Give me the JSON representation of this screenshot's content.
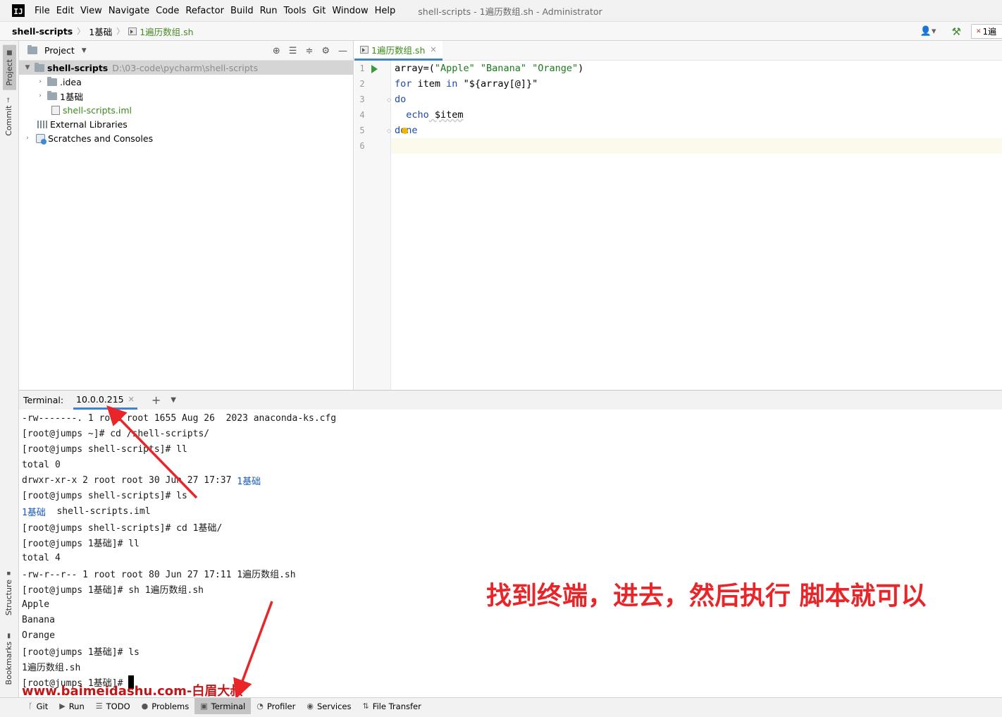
{
  "menubar": {
    "logo": "IJ",
    "items": [
      "File",
      "Edit",
      "View",
      "Navigate",
      "Code",
      "Refactor",
      "Build",
      "Run",
      "Tools",
      "Git",
      "Window",
      "Help"
    ],
    "window_title": "shell-scripts - 1遍历数组.sh - Administrator"
  },
  "navbar": {
    "project": "shell-scripts",
    "folder": "1基础",
    "file": "1遍历数组.sh",
    "run_config": "1遍"
  },
  "left_stripe": {
    "project": "Project",
    "commit": "Commit",
    "structure": "Structure",
    "bookmarks": "Bookmarks"
  },
  "project_pane": {
    "title": "Project",
    "tree": [
      {
        "name": "shell-scripts",
        "path": "D:\\03-code\\pycharm\\shell-scripts"
      },
      {
        "name": ".idea"
      },
      {
        "name": "1基础"
      },
      {
        "name": "shell-scripts.iml"
      },
      {
        "name": "External Libraries"
      },
      {
        "name": "Scratches and Consoles"
      }
    ]
  },
  "editor": {
    "tab": "1遍历数组.sh",
    "line_numbers": [
      "1",
      "2",
      "3",
      "4",
      "5",
      "6"
    ],
    "code": {
      "l1_a": "array=(",
      "l1_b": "\"Apple\" \"Banana\" \"Orange\"",
      "l1_c": ")",
      "l2_a": "for",
      "l2_b": " item ",
      "l2_c": "in",
      "l2_d": " \"${array[@]}\"",
      "l3": "do",
      "l4_a": "  echo",
      "l4_b": " $item",
      "l5": "done"
    }
  },
  "terminal": {
    "label": "Terminal:",
    "tab": "10.0.0.215",
    "lines": {
      "t1": "-rw-------. 1 root root 1655 Aug 26  2023 anaconda-ks.cfg",
      "t2": "[root@jumps ~]# cd /shell-scripts/",
      "t3": "[root@jumps shell-scripts]# ll",
      "t4": "total 0",
      "t5a": "drwxr-xr-x 2 root root 30 Jun 27 17:37 ",
      "t5b": "1基础",
      "t6": "[root@jumps shell-scripts]# ls",
      "t7a": "1基础",
      "t7b": "  shell-scripts.iml",
      "t8": "[root@jumps shell-scripts]# cd 1基础/",
      "t9": "[root@jumps 1基础]# ll",
      "t10": "total 4",
      "t11": "-rw-r--r-- 1 root root 80 Jun 27 17:11 1遍历数组.sh",
      "t12": "[root@jumps 1基础]# sh 1遍历数组.sh",
      "t13": "Apple",
      "t14": "Banana",
      "t15": "Orange",
      "t16": "[root@jumps 1基础]# ls",
      "t17": "1遍历数组.sh",
      "t18": "[root@jumps 1基础]#"
    },
    "annotation": "找到终端，进去，然后执行 脚本就可以",
    "watermark": "www.baimeidashu.com-白眉大叔"
  },
  "bottom_stripe": {
    "git": "Git",
    "run": "Run",
    "todo": "TODO",
    "problems": "Problems",
    "terminal": "Terminal",
    "profiler": "Profiler",
    "services": "Services",
    "file_transfer": "File Transfer"
  },
  "colors": {
    "accent": "#4083c9",
    "annotation_red": "#e8262a",
    "file_green": "#3a8a1a"
  }
}
